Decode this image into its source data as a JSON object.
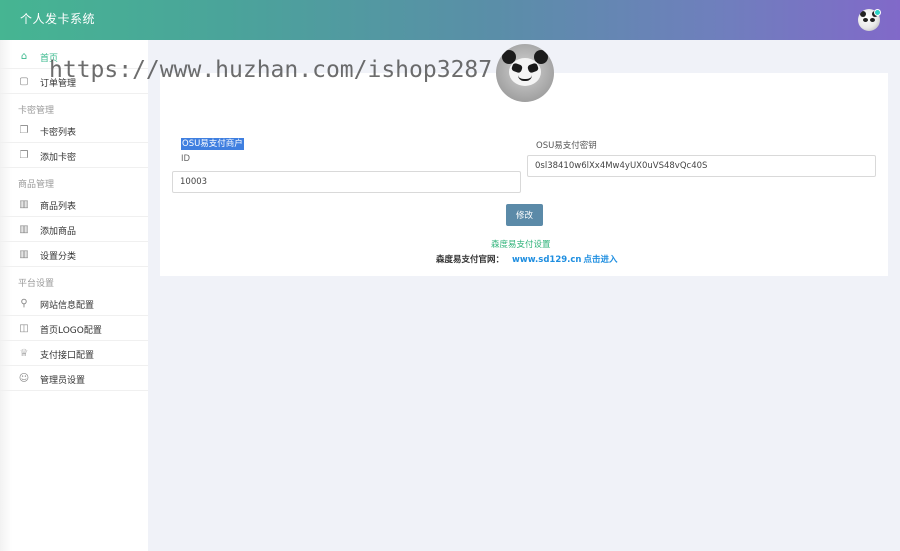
{
  "header": {
    "app_title": "个人发卡系统"
  },
  "sidebar": {
    "items": [
      {
        "label": "首页",
        "icon": "home-icon",
        "active": true
      },
      {
        "label": "订单管理",
        "icon": "clipboard-icon"
      }
    ],
    "sections": [
      {
        "title": "卡密管理",
        "items": [
          {
            "label": "卡密列表",
            "icon": "copy-icon"
          },
          {
            "label": "添加卡密",
            "icon": "copy-icon"
          }
        ]
      },
      {
        "title": "商品管理",
        "items": [
          {
            "label": "商品列表",
            "icon": "book-icon"
          },
          {
            "label": "添加商品",
            "icon": "book-icon"
          },
          {
            "label": "设置分类",
            "icon": "book-icon"
          }
        ]
      },
      {
        "title": "平台设置",
        "items": [
          {
            "label": "网站信息配置",
            "icon": "flag-icon"
          },
          {
            "label": "首页LOGO配置",
            "icon": "layout-icon"
          },
          {
            "label": "支付接口配置",
            "icon": "crown-icon"
          },
          {
            "label": "管理员设置",
            "icon": "smile-icon"
          }
        ]
      }
    ]
  },
  "form": {
    "merchant_label": "OSU易支付商户",
    "merchant_sublabel": "ID",
    "merchant_value": "10003",
    "key_label": "OSU易支付密钥",
    "key_value": "0sl38410w6lXx4Mw4yUX0uVS48vQc40S",
    "modify_button": "修改",
    "settings_link": "森度易支付设置",
    "site_label": "森度易支付官网：",
    "site_url": "www.sd129.cn",
    "site_enter": "点击进入"
  },
  "overlay": {
    "watermark": "https://www.huzhan.com/ishop3287"
  },
  "colors": {
    "accent": "#39b88c",
    "button": "#5b8aa8",
    "link": "#1e8ee0",
    "selection": "#3f7fe0"
  }
}
